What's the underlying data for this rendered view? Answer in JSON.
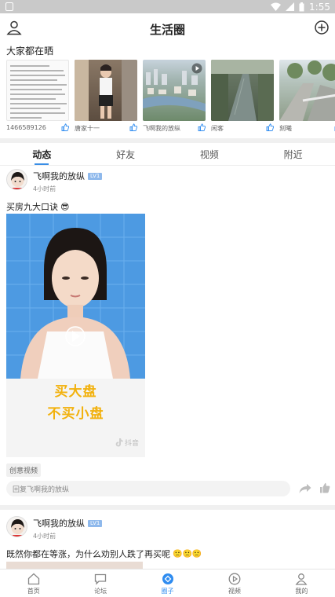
{
  "status_bar": {
    "time": "1:55"
  },
  "header": {
    "title": "生活圈"
  },
  "showcase": {
    "title": "大家都在晒",
    "items": [
      {
        "name": "1466589126",
        "thumb": "text-document"
      },
      {
        "name": "唐家十一",
        "thumb": "person-photo"
      },
      {
        "name": "飞啊我的放纵",
        "thumb": "city-aerial",
        "video": true
      },
      {
        "name": "闲客",
        "thumb": "river"
      },
      {
        "name": "刻曦",
        "thumb": "road-trees"
      }
    ]
  },
  "tabs": [
    {
      "label": "动态",
      "active": true
    },
    {
      "label": "好友",
      "active": false
    },
    {
      "label": "视频",
      "active": false
    },
    {
      "label": "附近",
      "active": false
    }
  ],
  "post1": {
    "author": "飞啊我的放纵",
    "level": "LV1",
    "time": "4小时前",
    "text": "买房九大口诀",
    "emoji": "😎",
    "video_caption_line1": "买大盘",
    "video_caption_line2": "不买小盘",
    "watermark": "抖音",
    "tag": "创意视频",
    "reply_placeholder": "回复飞啊我的放纵"
  },
  "post2": {
    "author": "飞啊我的放纵",
    "level": "LV1",
    "time": "4小时前",
    "text": "既然你都在等涨，为什么劝别人跌了再买呢",
    "emoji": "🙁🙁🙁"
  },
  "bottom_nav": [
    {
      "label": "首页",
      "icon": "home-icon",
      "active": false
    },
    {
      "label": "论坛",
      "icon": "forum-icon",
      "active": false
    },
    {
      "label": "圈子",
      "icon": "circle-icon",
      "active": true
    },
    {
      "label": "视频",
      "icon": "video-icon",
      "active": false
    },
    {
      "label": "我的",
      "icon": "profile-icon",
      "active": false
    }
  ],
  "colors": {
    "accent": "#2f8cf0",
    "video_bg": "#4b98e0",
    "caption": "#f2b10c"
  }
}
